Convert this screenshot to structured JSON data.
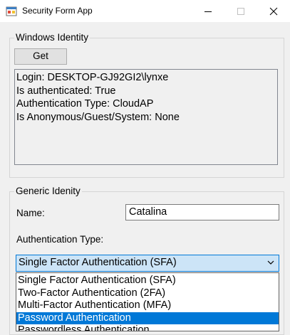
{
  "window": {
    "title": "Security Form App"
  },
  "windows_identity": {
    "group_title": "Windows Identity",
    "get_label": "Get",
    "output_lines": [
      "Login: DESKTOP-GJ92GI2\\lynxe",
      "Is authenticated: True",
      "Authentication Type: CloudAP",
      "Is Anonymous/Guest/System: None"
    ]
  },
  "generic_identity": {
    "group_title": "Generic Idenity",
    "name_label": "Name:",
    "name_value": "Catalina",
    "auth_type_label": "Authentication Type:",
    "auth_type_selected": "Single Factor Authentication (SFA)",
    "auth_type_options": [
      "Single Factor Authentication (SFA)",
      "Two-Factor Authentication (2FA)",
      "Multi-Factor Authentication (MFA)",
      "Password Authentication",
      "Passwordless Authentication"
    ],
    "highlighted_option_index": 3
  },
  "colors": {
    "selection": "#0078d7",
    "combo_focus_bg": "#cce4f7"
  }
}
